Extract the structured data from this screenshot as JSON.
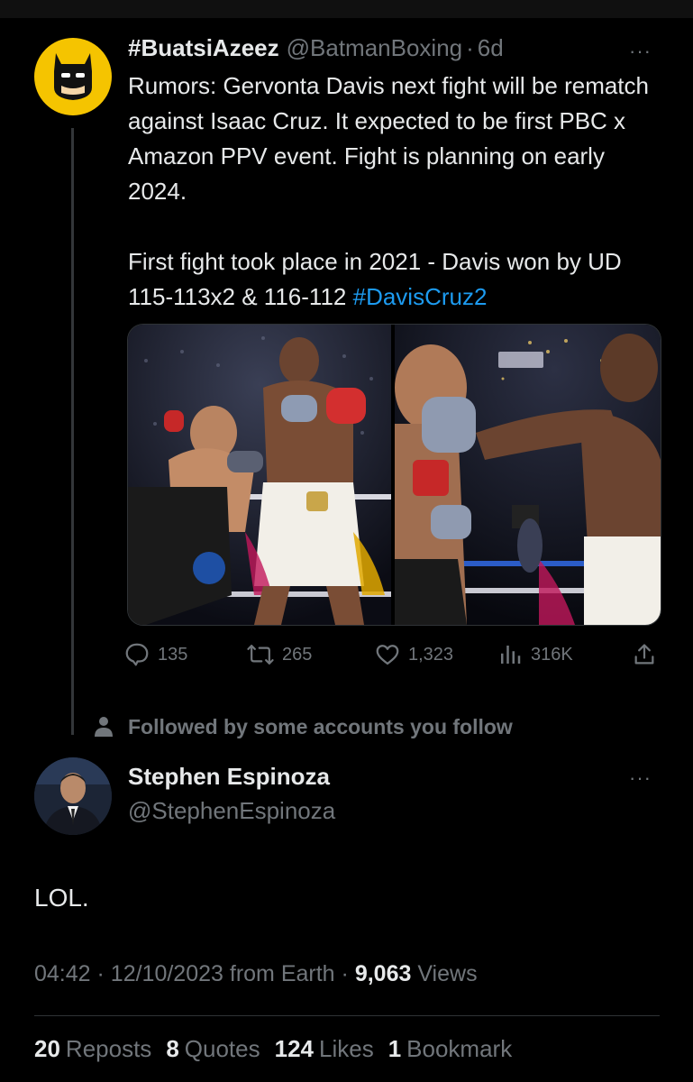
{
  "tweet": {
    "display_name": "#BuatsiAzeez",
    "handle": "@BatmanBoxing",
    "separator": "·",
    "time": "6d",
    "more": "···",
    "paragraph1": "Rumors: Gervonta Davis next fight will be rematch against Isaac Cruz. It expected to be first PBC x Amazon PPV event. Fight is planning on early 2024.",
    "paragraph2_text": "First fight took place in 2021 - Davis won by UD 115-113x2 & 116-112",
    "paragraph2_hashtag": "#DavisCruz2",
    "actions": {
      "replies": "135",
      "reposts": "265",
      "likes": "1,323",
      "views": "316K"
    }
  },
  "social_context": "Followed by some accounts you follow",
  "reply": {
    "display_name": "Stephen Espinoza",
    "handle": "@StephenEspinoza",
    "more": "···",
    "text": "LOL.",
    "meta": {
      "time": "04:42",
      "separator": "·",
      "date": "12/10/2023",
      "source": "from Earth",
      "views_count": "9,063",
      "views_label": "Views"
    },
    "stats": {
      "reposts_count": "20",
      "reposts_label": "Reposts",
      "quotes_count": "8",
      "quotes_label": "Quotes",
      "likes_count": "124",
      "likes_label": "Likes",
      "bookmarks_count": "1",
      "bookmarks_label": "Bookmark"
    }
  },
  "colors": {
    "background": "#000000",
    "text": "#e7e9ea",
    "secondary": "#71767b",
    "link": "#1d9bf0",
    "avatar_yellow": "#f5c400"
  },
  "icons": {
    "reply": "speech-bubble-icon",
    "repost": "repost-arrows-icon",
    "like": "heart-icon",
    "views": "bar-chart-icon",
    "share": "share-icon",
    "person": "person-icon"
  }
}
